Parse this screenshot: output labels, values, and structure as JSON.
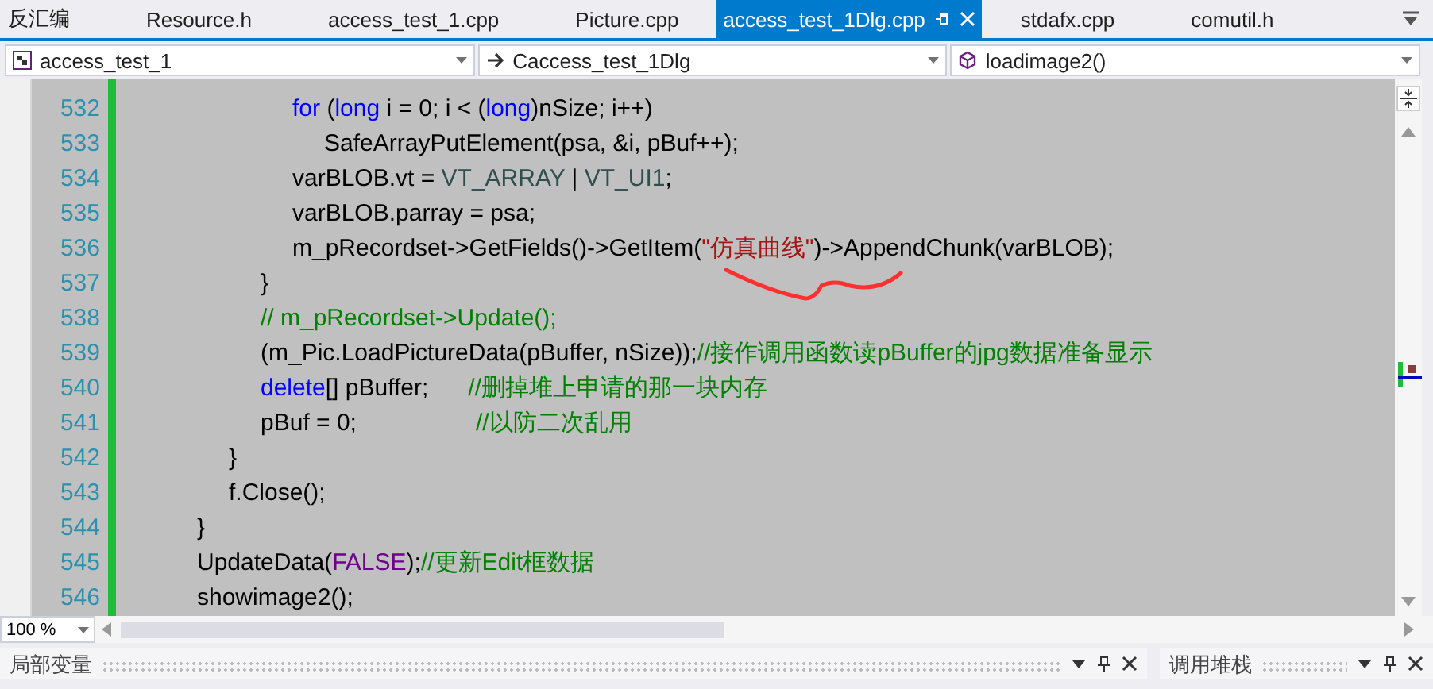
{
  "tabs": [
    {
      "label": "反汇编",
      "selected": false
    },
    {
      "label": "Resource.h",
      "selected": false
    },
    {
      "label": "access_test_1.cpp",
      "selected": false
    },
    {
      "label": "Picture.cpp",
      "selected": false
    },
    {
      "label": "access_test_1Dlg.cpp",
      "selected": true
    },
    {
      "label": "stdafx.cpp",
      "selected": false
    },
    {
      "label": "comutil.h",
      "selected": false
    }
  ],
  "navigation_bar": [
    {
      "kind": "project",
      "value": "access_test_1"
    },
    {
      "kind": "class",
      "value": "Caccess_test_1Dlg"
    },
    {
      "kind": "method",
      "value": "loadimage2()"
    }
  ],
  "code_lines": [
    {
      "number": "532",
      "tokens": [
        {
          "kind": "keyword",
          "text": "\t\t\t\t\tfor"
        },
        {
          "kind": "plain",
          "text": " ("
        },
        {
          "kind": "keyword",
          "text": "long"
        },
        {
          "kind": "plain",
          "text": " i = 0; i < ("
        },
        {
          "kind": "keyword",
          "text": "long"
        },
        {
          "kind": "plain",
          "text": ")nSize; i++)"
        }
      ]
    },
    {
      "number": "533",
      "tokens": [
        {
          "kind": "plain",
          "text": "\t\t\t\t\t\tSafeArrayPutElement(psa, &i, pBuf++);"
        }
      ]
    },
    {
      "number": "534",
      "tokens": [
        {
          "kind": "plain",
          "text": "\t\t\t\t\tvarBLOB.vt = "
        },
        {
          "kind": "macro",
          "text": "VT_ARRAY"
        },
        {
          "kind": "plain",
          "text": " | "
        },
        {
          "kind": "macro",
          "text": "VT_UI1"
        },
        {
          "kind": "plain",
          "text": ";"
        }
      ]
    },
    {
      "number": "535",
      "tokens": [
        {
          "kind": "plain",
          "text": "\t\t\t\t\tvarBLOB.parray = psa;"
        }
      ]
    },
    {
      "number": "536",
      "tokens": [
        {
          "kind": "plain",
          "text": "\t\t\t\t\tm_pRecordset->GetFields()->GetItem("
        },
        {
          "kind": "string",
          "text": "\"仿真曲线\""
        },
        {
          "kind": "plain",
          "text": ")->AppendChunk(varBLOB);"
        }
      ]
    },
    {
      "number": "537",
      "tokens": [
        {
          "kind": "plain",
          "text": "\t\t\t\t}"
        }
      ]
    },
    {
      "number": "538",
      "tokens": [
        {
          "kind": "comment",
          "text": "\t\t\t\t// m_pRecordset->Update();"
        }
      ]
    },
    {
      "number": "539",
      "tokens": [
        {
          "kind": "plain",
          "text": "\t\t\t\t(m_Pic.LoadPictureData(pBuffer, nSize));"
        },
        {
          "kind": "comment",
          "text": "//接作调用函数读pBuffer的jpg数据准备显示"
        }
      ]
    },
    {
      "number": "540",
      "tokens": [
        {
          "kind": "keyword",
          "text": "\t\t\t\tdelete"
        },
        {
          "kind": "plain",
          "text": "[] pBuffer;"
        },
        {
          "kind": "comment",
          "text": "      //删掉堆上申请的那一块内存"
        }
      ]
    },
    {
      "number": "541",
      "tokens": [
        {
          "kind": "plain",
          "text": "\t\t\t\tpBuf = 0;"
        },
        {
          "kind": "comment",
          "text": "                  //以防二次乱用"
        }
      ]
    },
    {
      "number": "542",
      "tokens": [
        {
          "kind": "plain",
          "text": "\t\t\t}"
        }
      ]
    },
    {
      "number": "543",
      "tokens": [
        {
          "kind": "plain",
          "text": "\t\t\tf.Close();"
        }
      ]
    },
    {
      "number": "544",
      "tokens": [
        {
          "kind": "plain",
          "text": "\t\t}"
        }
      ]
    },
    {
      "number": "545",
      "tokens": [
        {
          "kind": "plain",
          "text": "\t\tUpdateData("
        },
        {
          "kind": "constant",
          "text": "FALSE"
        },
        {
          "kind": "plain",
          "text": ");"
        },
        {
          "kind": "comment",
          "text": "//更新Edit框数据"
        }
      ]
    },
    {
      "number": "546",
      "tokens": [
        {
          "kind": "plain",
          "text": "\t\tshowimage2();"
        }
      ]
    }
  ],
  "zoom": {
    "value": "100 %"
  },
  "panels": [
    {
      "title": "局部变量"
    },
    {
      "title": "调用堆栈"
    }
  ]
}
